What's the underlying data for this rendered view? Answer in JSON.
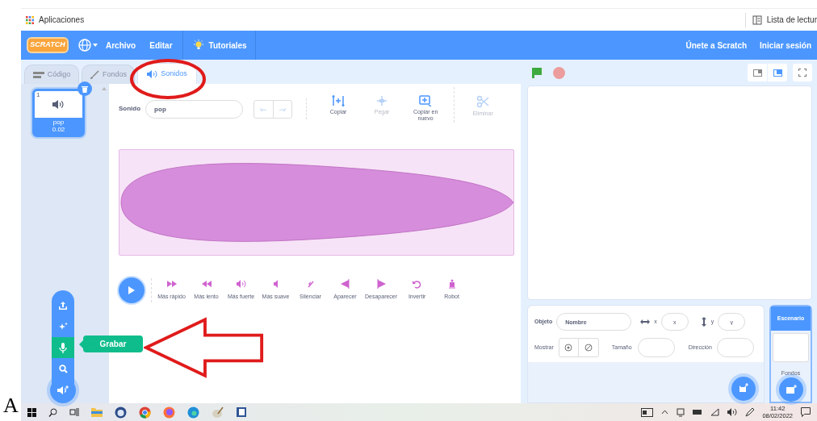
{
  "browser": {
    "bookmarks": [
      "Aplicaciones"
    ],
    "reading_list": "Lista de lectur"
  },
  "menu": {
    "logo": "SCRATCH",
    "items": [
      "Archivo",
      "Editar"
    ],
    "tutorials": "Tutoriales",
    "join": "Únete a Scratch",
    "sign_in": "Iniciar sesión"
  },
  "tabs": [
    {
      "label": "Código",
      "selected": false
    },
    {
      "label": "Fondos",
      "selected": false
    },
    {
      "label": "Sonidos",
      "selected": true
    }
  ],
  "sounds": [
    {
      "number": "1",
      "name": "pop",
      "duration": "0.02",
      "selected": true
    }
  ],
  "sound_editor": {
    "label": "Sonido",
    "name": "pop",
    "tools": [
      {
        "label": "Copiar",
        "disabled": false
      },
      {
        "label": "Pegar",
        "disabled": true
      },
      {
        "label": "Copiar en nuevo",
        "disabled": false
      },
      {
        "label": "Eliminar",
        "disabled": true
      }
    ],
    "effects": [
      "Más rápido",
      "Más lento",
      "Más fuerte",
      "Más suave",
      "Silenciar",
      "Aparecer",
      "Desaparecer",
      "Invertir",
      "Robot"
    ]
  },
  "add_sound_menu": {
    "tooltip": "Grabar"
  },
  "sprite_info": {
    "object_label": "Objeto",
    "name_placeholder": "Nombre",
    "x_label": "x",
    "x_placeholder": "x",
    "y_label": "y",
    "y_placeholder": "y",
    "show_label": "Mostrar",
    "size_label": "Tamaño",
    "direction_label": "Dirección"
  },
  "stage_pane": {
    "title": "Escenario",
    "backdrops_label": "Fondos"
  },
  "taskbar": {
    "time": "11:42",
    "date": "08/02/2022"
  },
  "margin_text": "A"
}
